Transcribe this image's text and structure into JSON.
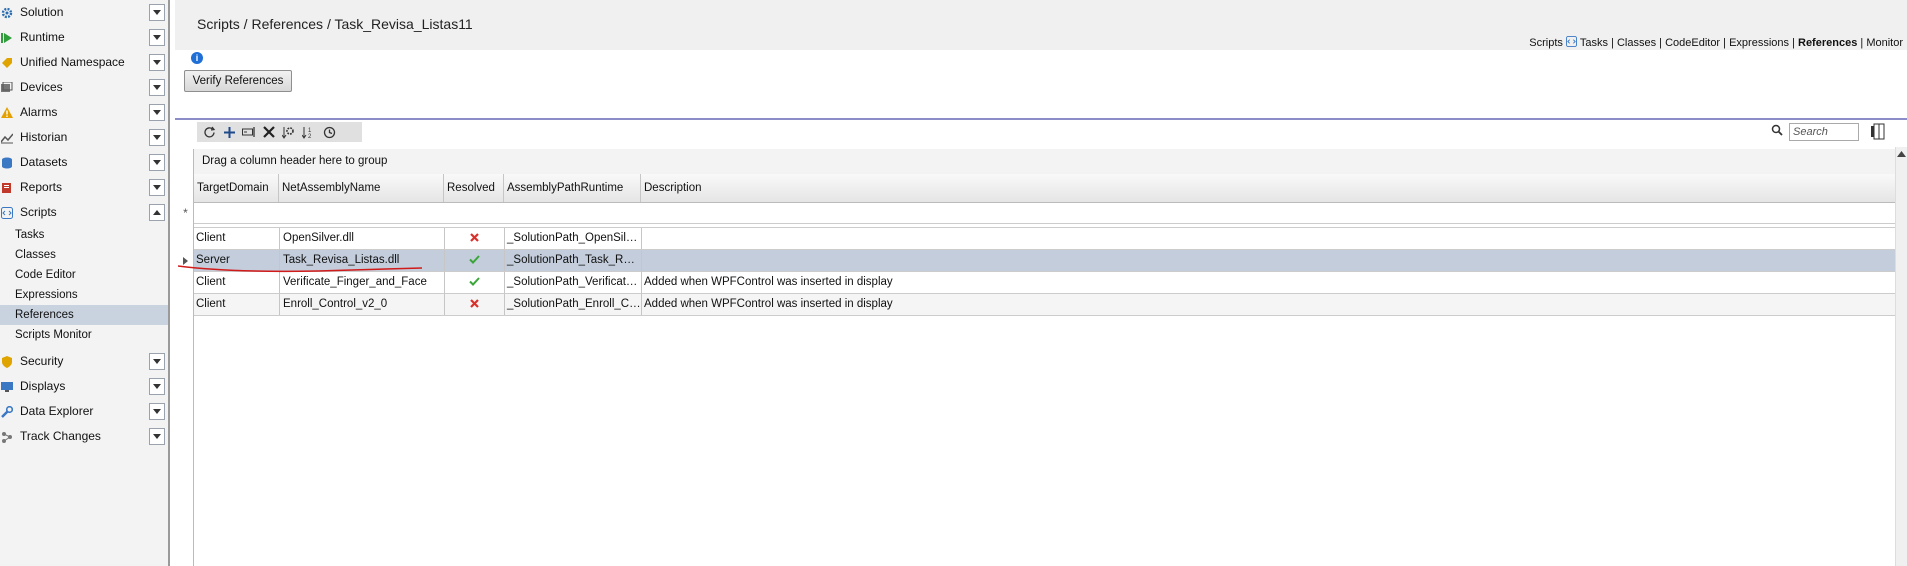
{
  "sidebar": {
    "items": [
      {
        "label": "Solution",
        "icon": "gear-icon",
        "color": "#2b6cb0"
      },
      {
        "label": "Runtime",
        "icon": "play-icon",
        "color": "#2e9d3a"
      },
      {
        "label": "Unified Namespace",
        "icon": "tag-icon",
        "color": "#e0a400"
      },
      {
        "label": "Devices",
        "icon": "devices-icon",
        "color": "#666666"
      },
      {
        "label": "Alarms",
        "icon": "alarm-icon",
        "color": "#e3a000"
      },
      {
        "label": "Historian",
        "icon": "historian-icon",
        "color": "#555555"
      },
      {
        "label": "Datasets",
        "icon": "dataset-icon",
        "color": "#3a78c4"
      },
      {
        "label": "Reports",
        "icon": "reports-icon",
        "color": "#c0392b"
      },
      {
        "label": "Scripts",
        "icon": "scripts-icon",
        "color": "#3a78c4"
      }
    ],
    "scripts_sub": [
      "Tasks",
      "Classes",
      "Code Editor",
      "Expressions",
      "References",
      "Scripts Monitor"
    ],
    "active_sub": "References",
    "bottom_items": [
      {
        "label": "Security",
        "icon": "shield-icon",
        "color": "#e0a400"
      },
      {
        "label": "Displays",
        "icon": "displays-icon",
        "color": "#3a78c4"
      },
      {
        "label": "Data Explorer",
        "icon": "wrench-icon",
        "color": "#3a78c4"
      },
      {
        "label": "Track Changes",
        "icon": "track-changes-icon",
        "color": "#777777"
      }
    ]
  },
  "header": {
    "breadcrumb": "Scripts / References / Task_Revisa_Listas11",
    "nav": {
      "section": "Scripts",
      "links": [
        "Tasks",
        "Classes",
        "CodeEditor",
        "Expressions",
        "References",
        "Monitor"
      ],
      "active": "References"
    }
  },
  "toolbar": {
    "verify_label": "Verify References",
    "search_placeholder": "Search"
  },
  "grid": {
    "group_hint": "Drag a column header here to group",
    "columns": [
      "TargetDomain",
      "NetAssemblyName",
      "Resolved",
      "AssemblyPathRuntime",
      "Description"
    ],
    "rows": [
      {
        "domain": "Client",
        "name": "OpenSilver.dll",
        "resolved": false,
        "path": "_SolutionPath_OpenSilver.dll",
        "description": ""
      },
      {
        "domain": "Server",
        "name": "Task_Revisa_Listas.dll",
        "resolved": true,
        "path": "_SolutionPath_Task_Revisa_Li...",
        "description": ""
      },
      {
        "domain": "Client",
        "name": "Verificate_Finger_and_Face",
        "resolved": true,
        "path": "_SolutionPath_Verificate_Fing...",
        "description": "Added when WPFControl was inserted in display"
      },
      {
        "domain": "Client",
        "name": "Enroll_Control_v2_0",
        "resolved": false,
        "path": "_SolutionPath_Enroll_Control...",
        "description": "Added when WPFControl was inserted in display"
      }
    ],
    "selected_row": 1
  },
  "colors": {
    "accent": "#8c8cc8",
    "selected": "#c3cddb",
    "ok": "#3aa63a",
    "error": "#d9302b",
    "annotation": "#d11a1a"
  }
}
